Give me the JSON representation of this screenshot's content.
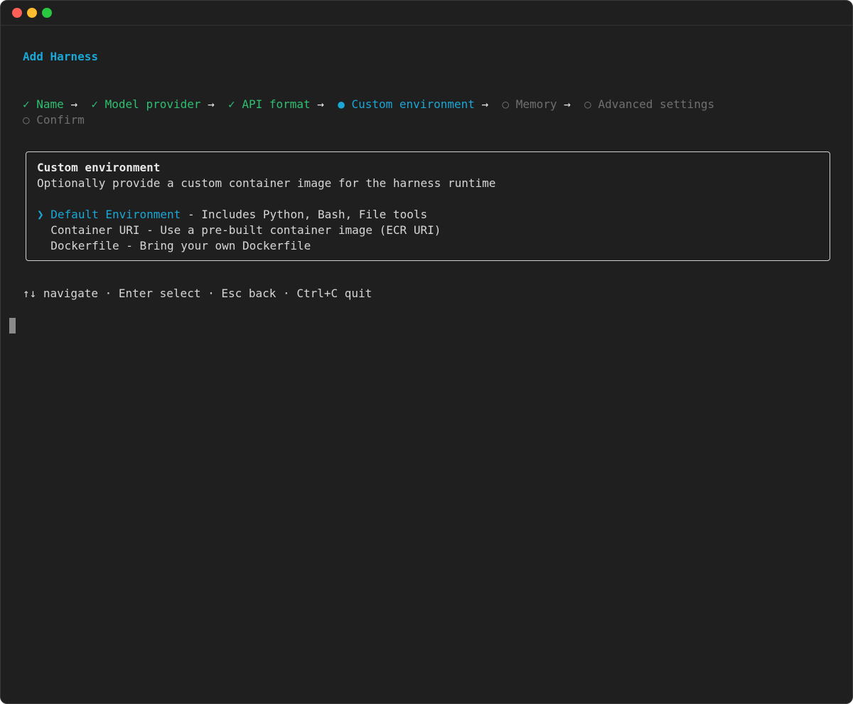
{
  "window": {
    "controls": [
      "close",
      "minimize",
      "maximize"
    ]
  },
  "title": "Add Harness",
  "steps": [
    {
      "symbol": "✓",
      "label": "Name"
    },
    {
      "symbol": "✓",
      "label": "Model provider"
    },
    {
      "symbol": "✓",
      "label": "API format"
    },
    {
      "symbol": "●",
      "label": "Custom environment"
    },
    {
      "symbol": "○",
      "label": "Memory"
    },
    {
      "symbol": "○",
      "label": "Advanced settings"
    },
    {
      "symbol": "○",
      "label": "Confirm"
    }
  ],
  "arrow": "→",
  "panel": {
    "heading": "Custom environment",
    "description": "Optionally provide a custom container image for the harness runtime",
    "pointer": "❯",
    "options": [
      {
        "name": "Default Environment",
        "desc": " - Includes Python, Bash, File tools"
      },
      {
        "name": "Container URI",
        "desc": " - Use a pre-built container image (ECR URI)"
      },
      {
        "name": "Dockerfile",
        "desc": " - Bring your own Dockerfile"
      }
    ]
  },
  "help": "↑↓ navigate · Enter select · Esc back · Ctrl+C quit",
  "colors": {
    "accent": "#1aa7d6",
    "done": "#2fbf71",
    "pending": "#6f6f6f",
    "background": "#1f1f1f"
  }
}
